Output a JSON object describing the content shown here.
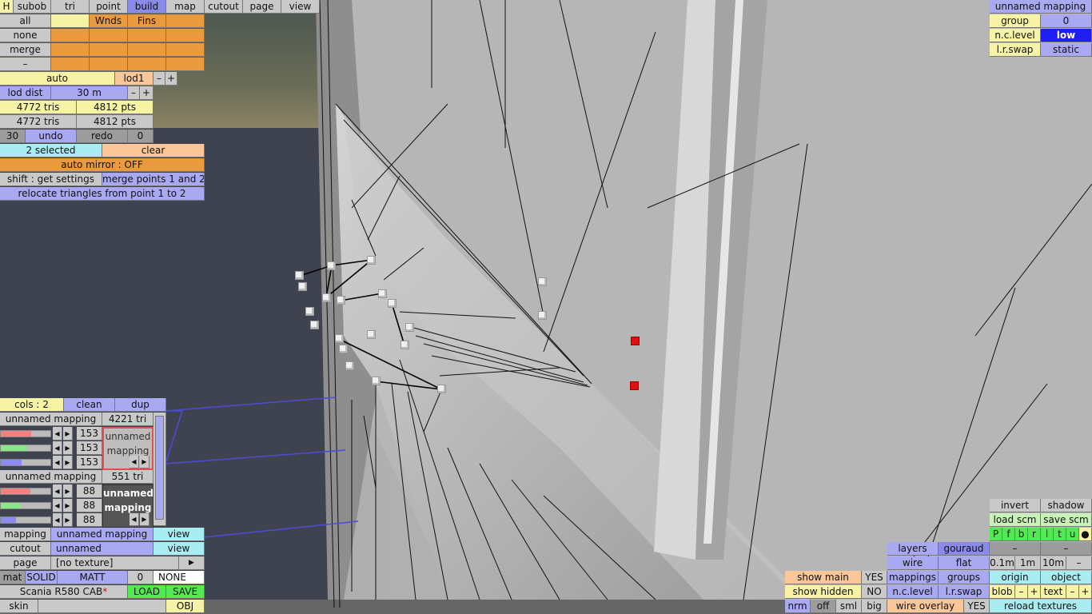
{
  "colors": {
    "gray": "#c9c9c9",
    "blue": "#a9a9f2",
    "yellow": "#f6f3a6",
    "orange": "#e99a3e",
    "peach": "#fac79a",
    "cyan": "#a9ecf2",
    "green": "#54e854",
    "deepblue": "#1e1ef0"
  },
  "menu": {
    "h": "H",
    "subob": "subob",
    "tri": "tri",
    "point": "point",
    "build": "build",
    "map": "map",
    "cutout": "cutout",
    "page": "page",
    "view": "view"
  },
  "groups": {
    "all": "all",
    "none": "none",
    "merge": "merge",
    "dash": "–",
    "wnds": "Wnds",
    "fins": "Fins"
  },
  "lod": {
    "auto": "auto",
    "lod1": "lod1",
    "minus": "–",
    "plus": "+",
    "dist_label": "lod dist",
    "dist_value": "30 m",
    "tris1": "4772 tris",
    "pts1": "4812 pts",
    "tris2": "4772 tris",
    "pts2": "4812 pts"
  },
  "history": {
    "count": "30",
    "undo": "undo",
    "redo": "redo",
    "redo_count": "0"
  },
  "selection": {
    "selected": "2 selected",
    "clear": "clear",
    "auto_mirror": "auto mirror : OFF",
    "shift_get": "shift : get settings",
    "merge_points": "merge points 1 and 2",
    "relocate": "relocate triangles from point 1 to 2"
  },
  "cols": {
    "label": "cols : 2",
    "clean": "clean",
    "dup": "dup"
  },
  "mappings": [
    {
      "name": "unnamed mapping",
      "tris": "4221 tri",
      "values": [
        "153",
        "153",
        "153"
      ],
      "swatch": "unnamed\nmapping",
      "fills": [
        0.62,
        0.52,
        0.42
      ]
    },
    {
      "name": "unnamed mapping",
      "tris": "551 tri",
      "values": [
        "88",
        "88",
        "88"
      ],
      "swatch": "unnamed\nmapping",
      "fills": [
        0.6,
        0.4,
        0.3
      ]
    }
  ],
  "bottom_left": {
    "mapping_label": "mapping",
    "mapping_value": "unnamed mapping",
    "mapping_view": "view",
    "cutout_label": "cutout",
    "cutout_value": "unnamed",
    "cutout_view": "view",
    "page_label": "page",
    "page_value": "[no texture]",
    "page_arrow": "▶",
    "mat": "mat",
    "solid": "SOLID",
    "matt": "MATT",
    "mat_num": "0",
    "mat_none": "NONE",
    "model_name": "Scania R580 CAB",
    "model_star": "*",
    "load": "LOAD",
    "save": "SAVE",
    "skin": "skin",
    "obj": "OBJ"
  },
  "top_right": {
    "mapping": "unnamed mapping",
    "group_label": "group",
    "group_value": "0",
    "nc_level_label": "n.c.level",
    "nc_level_value": "low",
    "lr_swap": "l.r.swap",
    "static": "static"
  },
  "bottom_right": {
    "invert": "invert",
    "shadow": "shadow",
    "load_scm": "load scm",
    "save_scm": "save scm",
    "letters": [
      "P",
      "f",
      "b",
      "r",
      "l",
      "t",
      "u",
      "●"
    ],
    "layers": "layers",
    "gouraud": "gouraud",
    "dash1": "–",
    "dash2": "–",
    "wire": "wire",
    "flat": "flat",
    "s01": "0.1m",
    "s1": "1m",
    "s10": "10m",
    "sminus": "–",
    "mappings": "mappings",
    "groups": "groups",
    "origin": "origin",
    "object": "object",
    "nc_level": "n.c.level",
    "lr_swap": "l.r.swap",
    "blob": "blob",
    "blob_m": "–",
    "blob_p": "+",
    "text": "text",
    "text_m": "–",
    "text_p": "+",
    "wire_overlay": "wire overlay",
    "wire_overlay_v": "YES",
    "reload": "reload textures",
    "show_main": "show main",
    "show_main_v": "YES",
    "show_hidden": "show hidden",
    "show_hidden_v": "NO",
    "nrm": "nrm",
    "off": "off",
    "sml": "sml",
    "big": "big"
  }
}
